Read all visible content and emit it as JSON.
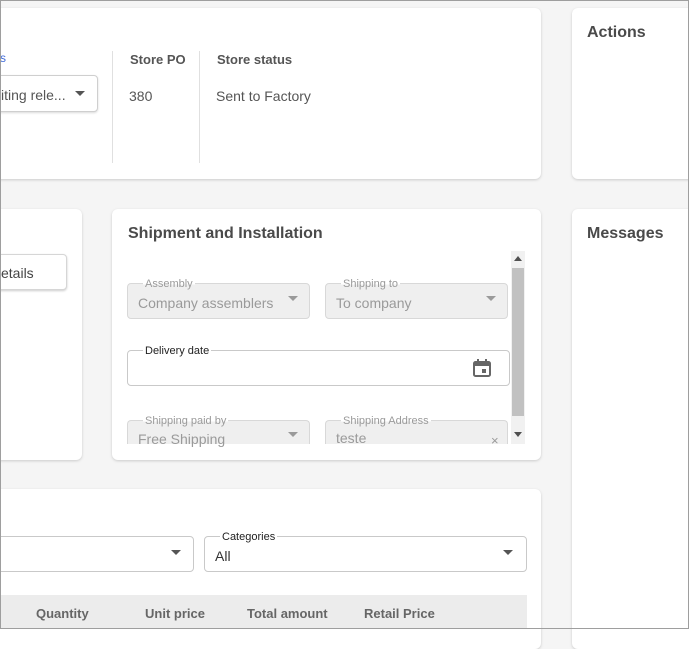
{
  "top": {
    "status_label": "s",
    "status_value": "iting rele...",
    "store_po_header": "Store PO",
    "store_po_value": "380",
    "store_status_header": "Store status",
    "store_status_value": "Sent to Factory"
  },
  "actions": {
    "title": "Actions"
  },
  "messages": {
    "title": "Messages"
  },
  "details": {
    "button_label": "etails"
  },
  "shipment": {
    "title": "Shipment and Installation",
    "assembly_label": "Assembly",
    "assembly_value": "Company assemblers",
    "shipping_to_label": "Shipping to",
    "shipping_to_value": "To company",
    "delivery_date_label": "Delivery date",
    "delivery_date_value": "",
    "shipping_paid_by_label": "Shipping paid by",
    "shipping_paid_by_value": "Free Shipping",
    "shipping_address_label": "Shipping Address",
    "shipping_address_value": "teste"
  },
  "products": {
    "categories_label": "Categories",
    "categories_value": "All",
    "columns": [
      "Quantity",
      "Unit price",
      "Total amount",
      "Retail Price"
    ]
  }
}
